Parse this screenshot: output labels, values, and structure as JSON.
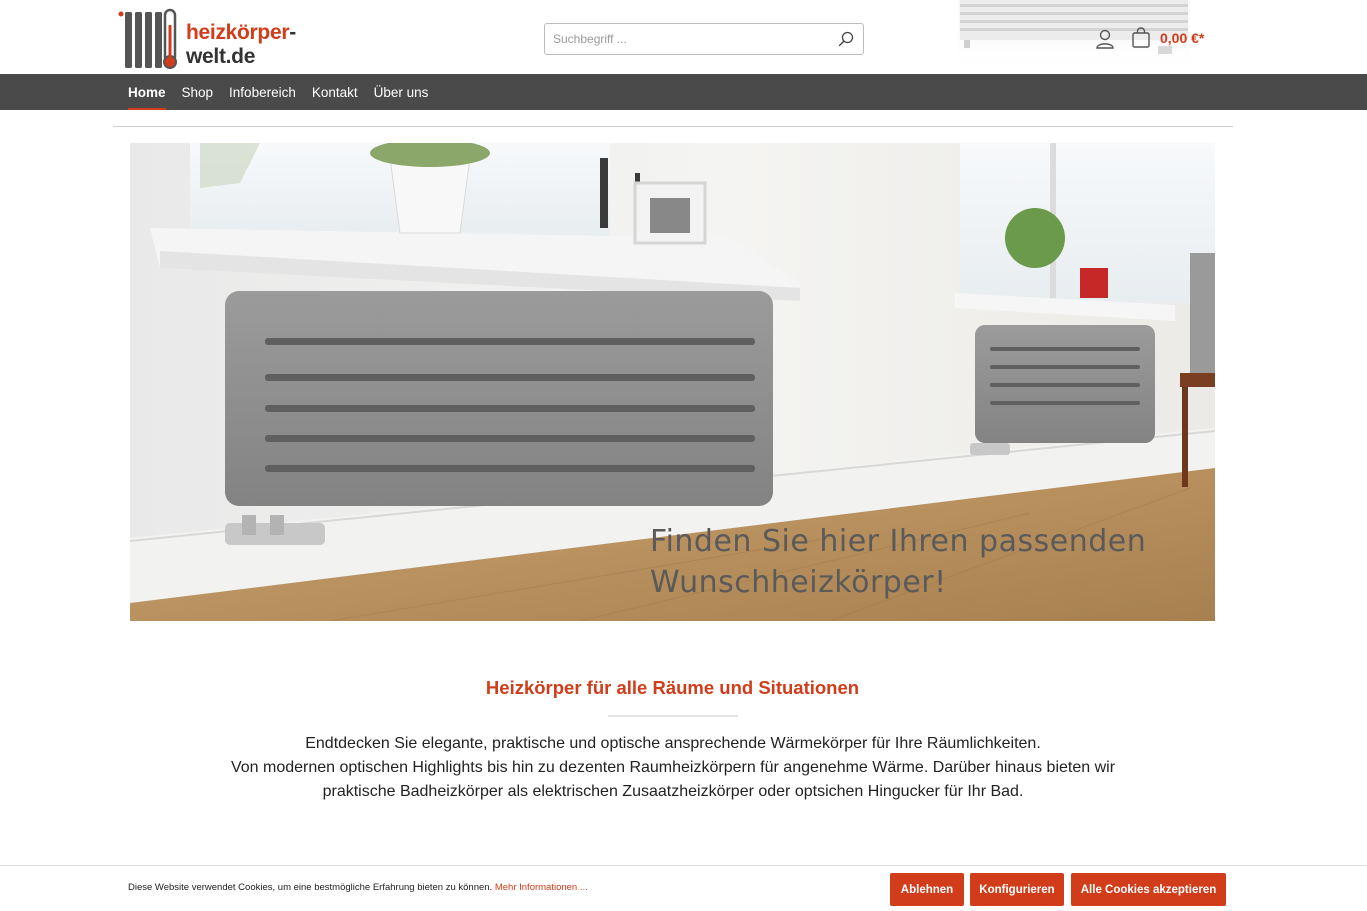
{
  "brand": {
    "logo_text_accent": "heizkörper",
    "logo_text_rest": "-welt.de",
    "logo_icon": "radiator-thermometer-icon",
    "accent_color": "#d13c1a"
  },
  "header": {
    "search_placeholder": "Suchbegriff ...",
    "cart_total": "0,00 €*"
  },
  "nav": {
    "items": [
      {
        "label": "Home",
        "active": true
      },
      {
        "label": "Shop",
        "active": false
      },
      {
        "label": "Infobereich",
        "active": false
      },
      {
        "label": "Kontakt",
        "active": false
      },
      {
        "label": "Über uns",
        "active": false
      }
    ]
  },
  "hero": {
    "line1": "Finden Sie hier Ihren passenden",
    "line2": "Wunschheizkörper!"
  },
  "intro": {
    "title": "Heizkörper für alle Räume und Situationen",
    "line1": "Endtdecken Sie elegante, praktische und optische ansprechende Wärmekörper für Ihre Räumlichkeiten.",
    "line2": "Von modernen optischen Highlights bis hin zu dezenten Raumheizkörpern für angenehme Wärme. Darüber hinaus bieten wir praktische Badheizkörper als elektrischen Zusaatzheizkörper oder optsichen Hingucker für Ihr Bad."
  },
  "cookie": {
    "text": "Diese Website verwendet Cookies, um eine bestmögliche Erfahrung bieten zu können.",
    "link": "Mehr Informationen ...",
    "reject": "Ablehnen",
    "configure": "Konfigurieren",
    "accept_all": "Alle Cookies akzeptieren"
  }
}
